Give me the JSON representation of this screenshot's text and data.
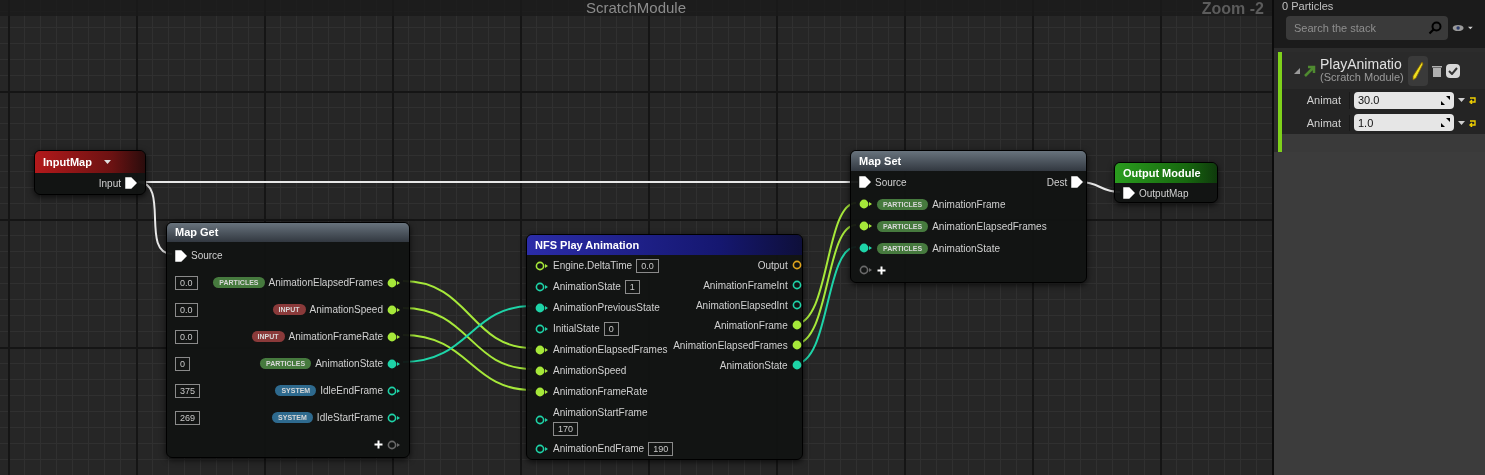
{
  "graph": {
    "title": "ScratchModule",
    "zoom": "Zoom -2",
    "nodes": [
      {
        "kind": "input",
        "title": "InputMap",
        "outputs": [
          {
            "kind": "exec",
            "label": "Input",
            "connected": true
          }
        ]
      },
      {
        "kind": "map",
        "title": "Map Get",
        "inputs": [
          {
            "kind": "exec",
            "label": "Source",
            "connected": true
          }
        ],
        "outputs": [
          {
            "kind": "float",
            "label": "AnimationElapsedFrames",
            "tag": {
              "text": "PARTICLES",
              "color": "#467a3e"
            },
            "default": "0.0",
            "connected": true
          },
          {
            "kind": "float",
            "label": "AnimationSpeed",
            "tag": {
              "text": "INPUT",
              "color": "#8a3a3a"
            },
            "default": "0.0",
            "connected": true
          },
          {
            "kind": "float",
            "label": "AnimationFrameRate",
            "tag": {
              "text": "INPUT",
              "color": "#8a3a3a"
            },
            "default": "0.0",
            "connected": true
          },
          {
            "kind": "int",
            "label": "AnimationState",
            "tag": {
              "text": "PARTICLES",
              "color": "#467a3e"
            },
            "default": "0",
            "connected": true
          },
          {
            "kind": "int",
            "label": "IdleEndFrame",
            "tag": {
              "text": "SYSTEM",
              "color": "#2e6a8e"
            },
            "default": "375",
            "connected": false
          },
          {
            "kind": "int",
            "label": "IdleStartFrame",
            "tag": {
              "text": "SYSTEM",
              "color": "#2e6a8e"
            },
            "default": "269",
            "connected": false
          },
          {
            "kind": "add",
            "connected": false
          }
        ]
      },
      {
        "kind": "function",
        "title": "NFS Play Animation",
        "inputs": [
          {
            "kind": "float",
            "label": "Engine.DeltaTime",
            "default": "0.0",
            "connected": false
          },
          {
            "kind": "int",
            "label": "AnimationState",
            "default": "1",
            "connected": false
          },
          {
            "kind": "int",
            "label": "AnimationPreviousState",
            "connected": true
          },
          {
            "kind": "int",
            "label": "InitialState",
            "default": "0",
            "connected": false
          },
          {
            "kind": "float",
            "label": "AnimationElapsedFrames",
            "connected": true
          },
          {
            "kind": "float",
            "label": "AnimationSpeed",
            "connected": true
          },
          {
            "kind": "float",
            "label": "AnimationFrameRate",
            "connected": true
          },
          {
            "kind": "int",
            "label": "AnimationStartFrame",
            "default": "170",
            "default_below": true,
            "connected": false
          },
          {
            "kind": "int",
            "label": "AnimationEndFrame",
            "default": "190",
            "connected": false
          }
        ],
        "outputs": [
          {
            "kind": "map",
            "label": "Output",
            "connected": false
          },
          {
            "kind": "int",
            "label": "AnimationFrameInt",
            "connected": false
          },
          {
            "kind": "int",
            "label": "AnimationElapsedInt",
            "connected": false
          },
          {
            "kind": "float",
            "label": "AnimationFrame",
            "connected": true
          },
          {
            "kind": "float",
            "label": "AnimationElapsedFrames",
            "connected": true
          },
          {
            "kind": "int",
            "label": "AnimationState",
            "connected": true
          }
        ]
      },
      {
        "kind": "map",
        "title": "Map Set",
        "inputs": [
          {
            "kind": "exec",
            "label": "Source",
            "connected": true
          },
          {
            "kind": "float",
            "label": "AnimationFrame",
            "tag": {
              "text": "PARTICLES",
              "color": "#467a3e"
            },
            "connected": true
          },
          {
            "kind": "float",
            "label": "AnimationElapsedFrames",
            "tag": {
              "text": "PARTICLES",
              "color": "#467a3e"
            },
            "connected": true
          },
          {
            "kind": "int",
            "label": "AnimationState",
            "tag": {
              "text": "PARTICLES",
              "color": "#467a3e"
            },
            "connected": true
          },
          {
            "kind": "add",
            "connected": false
          }
        ],
        "outputs": [
          {
            "kind": "exec",
            "label": "Dest",
            "connected": true
          }
        ]
      },
      {
        "kind": "output",
        "title": "Output Module",
        "inputs": [
          {
            "kind": "exec",
            "label": "OutputMap",
            "connected": true
          }
        ]
      }
    ]
  },
  "stack": {
    "count": "0 Particles",
    "search": {
      "placeholder": "Search the stack"
    },
    "module": {
      "title": "PlayAnimatio",
      "subtitle": "(Scratch Module)",
      "enabled": true,
      "parameters": [
        {
          "label": "Animat",
          "value": "30.0"
        },
        {
          "label": "Animat",
          "value": "1.0"
        }
      ]
    }
  }
}
